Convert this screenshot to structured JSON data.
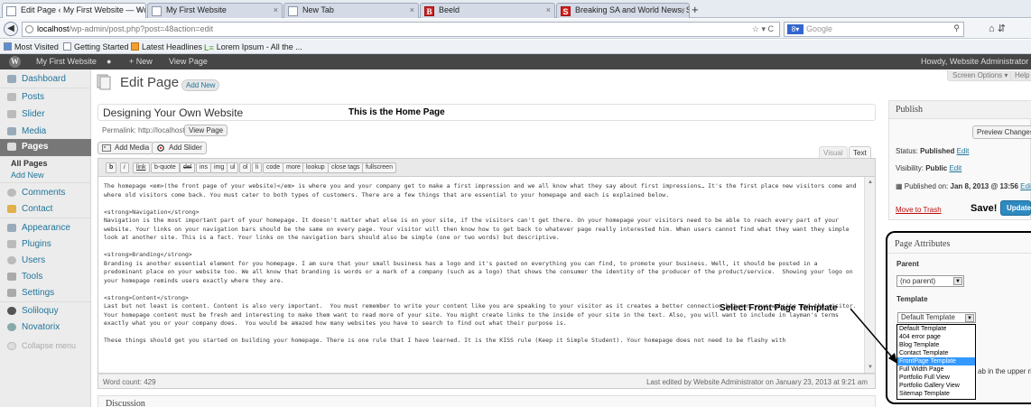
{
  "browser": {
    "tabs": [
      {
        "label": "Edit Page ‹ My First Website — Word...",
        "close": "×"
      },
      {
        "label": "My First Website",
        "close": "×"
      },
      {
        "label": "New Tab",
        "close": "×"
      },
      {
        "label": "Beeld",
        "close": "×"
      },
      {
        "label": "Breaking SA and World News, Sports, ...",
        "close": "×"
      }
    ],
    "newtab_label": "+",
    "url_host": "localhost",
    "url_path": "/wp-admin/post.php?post=48action=edit",
    "search_placeholder": "Google",
    "bookmarks": [
      "Most Visited",
      "Getting Started",
      "Latest Headlines",
      "Lorem Ipsum - All the ..."
    ]
  },
  "adminbar": {
    "site_name": "My First Website",
    "new_label": "+ New",
    "view_page_label": "View Page",
    "howdy": "Howdy, Website Administrator"
  },
  "sidebar": {
    "items": [
      {
        "label": "Dashboard"
      },
      {
        "label": "Posts"
      },
      {
        "label": "Slider"
      },
      {
        "label": "Media"
      },
      {
        "label": "Pages"
      },
      {
        "label": "All Pages"
      },
      {
        "label": "Add New"
      },
      {
        "label": "Comments"
      },
      {
        "label": "Contact"
      },
      {
        "label": "Appearance"
      },
      {
        "label": "Plugins"
      },
      {
        "label": "Users"
      },
      {
        "label": "Tools"
      },
      {
        "label": "Settings"
      },
      {
        "label": "Soliloquy"
      },
      {
        "label": "Novatorix"
      },
      {
        "label": "Collapse menu"
      }
    ]
  },
  "header": {
    "title": "Edit Page",
    "add_new": "Add New",
    "screen_options": "Screen Options ▾",
    "help": "Help"
  },
  "post": {
    "title": "Designing Your Own Website",
    "permalink_label": "Permalink: http://localhost/",
    "view_page_btn": "View Page",
    "add_media": "Add Media",
    "add_slider": "Add Slider",
    "tab_visual": "Visual",
    "tab_text": "Text",
    "quicktags": [
      "b",
      "i",
      "link",
      "b-quote",
      "del",
      "ins",
      "img",
      "ul",
      "ol",
      "li",
      "code",
      "more",
      "lookup",
      "close tags",
      "fullscreen"
    ],
    "content": "The homepage <em>(the front page of your website)</em> is where you and your company get to make a first impression and we all know what they say about first impressions… It's the first place new visitors come and where old visitors come back. You must cater to both types of customers. There are a few things that are essential to your homepage and each is explained below.\n\n<strong>Navigation</strong>\nNavigation is the most important part of your homepage. It doesn't matter what else is on your site, if the visitors can't get there. On your homepage your visitors need to be able to reach every part of your website. Your links on your navigation bars should be the same on every page. Your visitor will then know how to get back to whatever page really interested him. When users cannot find what they want they simple look at another site. This is a fact. Your links on the navigation bars should also be simple (one or two words) but descriptive.\n\n<strong>Branding</strong>\nBranding is another essential element for you homepage. I am sure that your small business has a logo and it's pasted on everything you can find, to promote your business. Well, it should be posted in a predominant place on your website too. We all know that branding is words or a mark of a company (such as a logo) that shows the consumer the identity of the producer of the product/service.  Showing your logo on your homepage reminds users exactly where they are.\n\n<strong>Content</strong>\nLast but not least is content. Content is also very important.  You must remember to write your content like you are speaking to your visitor as it creates a better connection between your website and the visitor. Your homepage content must be fresh and interesting to make them want to read more of your site. You might create links to the inside of your site in the text. Also, you will want to include in layman's terms exactly what you or your company does.  You would be amazed how many websites you have to search to find out what their purpose is.\n\nThese things should get you started on building your homepage. There is one rule that I have learned. It is the KISS rule (Keep it Simple Student). Your homepage does not need to be flashy with",
    "word_count": "Word count: 429",
    "last_edited": "Last edited by Website Administrator on January 23, 2013 at 9:21 am",
    "discussion": "Discussion"
  },
  "publish": {
    "title": "Publish",
    "preview": "Preview Changes",
    "status_label": "Status:",
    "status_value": "Published",
    "visibility_label": "Visibility:",
    "visibility_value": "Public",
    "published_label": "Published on:",
    "published_value": "Jan 8, 2013 @ 13:56",
    "edit": "Edit",
    "trash": "Move to Trash",
    "update": "Update"
  },
  "page_attributes": {
    "title": "Page Attributes",
    "parent_label": "Parent",
    "parent_value": "(no parent)",
    "template_label": "Template",
    "template_value": "Default Template",
    "template_options": [
      "Default Template",
      "404 error page",
      "Blog Template",
      "Contact Template",
      "FrontPage Template",
      "Full Width Page",
      "Portfolio Full View",
      "Portfolio Gallery View",
      "Sitemap Template"
    ],
    "selected_index": 4,
    "hidden_text": "ab in the upper righ"
  },
  "annotations": {
    "home": "This is the Home Page",
    "template": "Select Front Page Template",
    "save": "Save!"
  },
  "colors": {
    "link": "#21759b",
    "adminbar": "#464646",
    "update_button": "#2e8ac0",
    "selected_option": "#3399ff"
  }
}
